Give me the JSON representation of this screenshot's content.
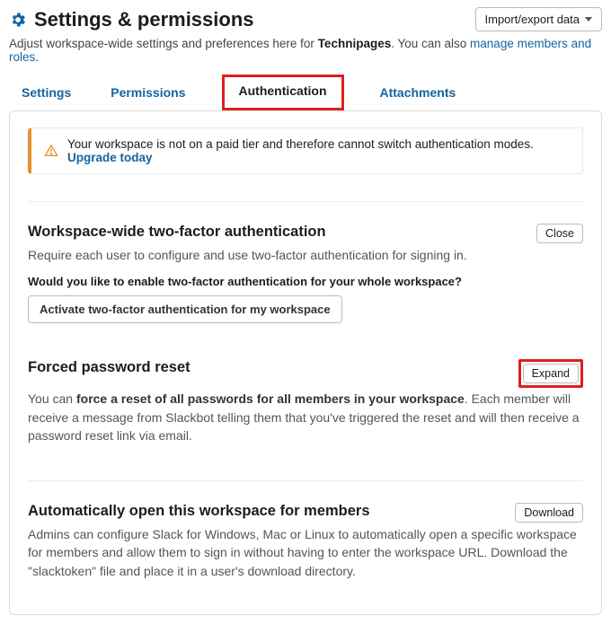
{
  "header": {
    "title": "Settings & permissions",
    "import_export_label": "Import/export data"
  },
  "subhead": {
    "prefix": "Adjust workspace-wide settings and preferences here for ",
    "workspace": "Technipages",
    "mid": ". You can also ",
    "link": "manage members and roles",
    "suffix": "."
  },
  "tabs": {
    "settings": "Settings",
    "permissions": "Permissions",
    "authentication": "Authentication",
    "attachments": "Attachments"
  },
  "alert": {
    "text": "Your workspace is not on a paid tier and therefore cannot switch authentication modes. ",
    "link": "Upgrade today"
  },
  "sections": {
    "twofa": {
      "title": "Workspace-wide two-factor authentication",
      "desc": "Require each user to configure and use two-factor authentication for signing in.",
      "prompt": "Would you like to enable two-factor authentication for your whole workspace?",
      "activate_btn": "Activate two-factor authentication for my workspace",
      "close_btn": "Close"
    },
    "forced": {
      "title": "Forced password reset",
      "desc_pre": "You can ",
      "desc_bold": "force a reset of all passwords for all members in your workspace",
      "desc_post": ". Each member will receive a message from Slackbot telling them that you've triggered the reset and will then receive a password reset link via email.",
      "expand_btn": "Expand"
    },
    "auto": {
      "title": "Automatically open this workspace for members",
      "desc": "Admins can configure Slack for Windows, Mac or Linux to automatically open a specific workspace for members and allow them to sign in without having to enter the workspace URL. Download the \"slacktoken\" file and place it in a user's download directory.",
      "download_btn": "Download"
    }
  }
}
